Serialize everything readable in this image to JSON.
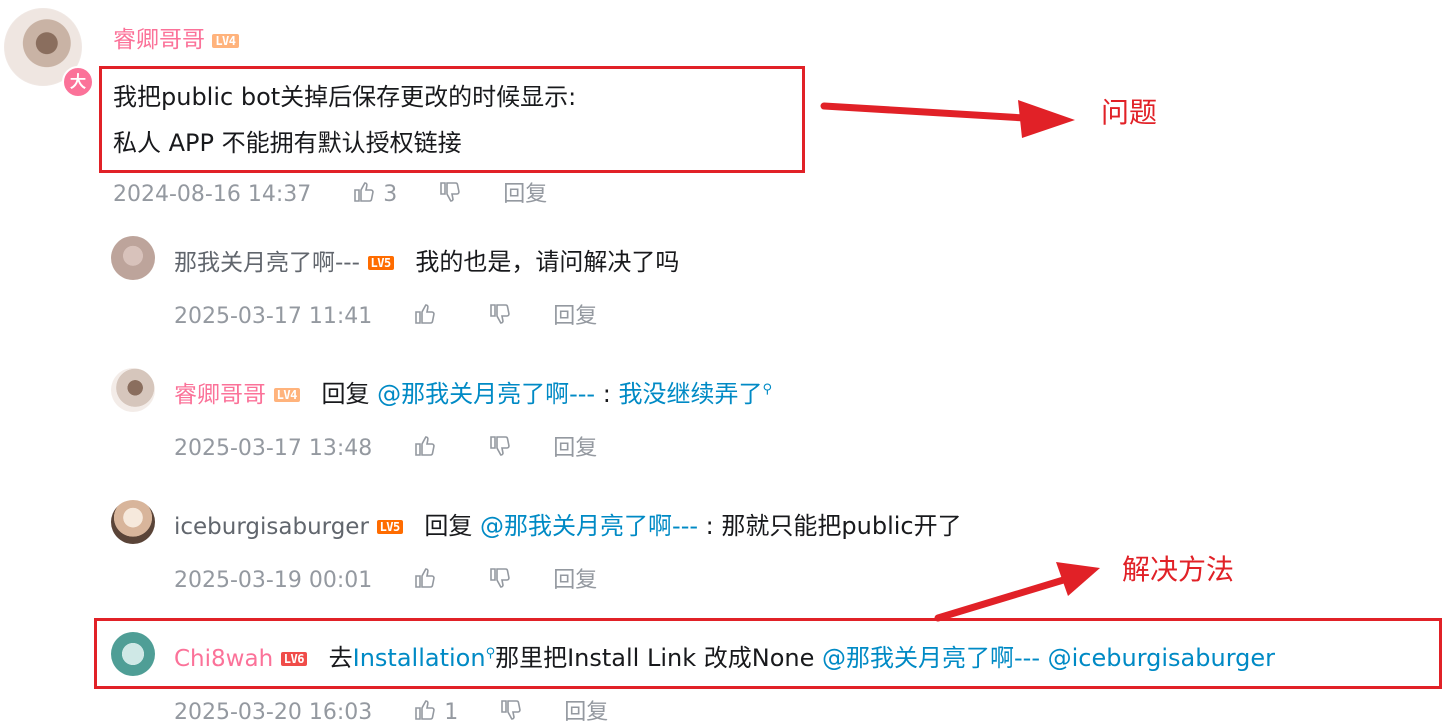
{
  "colors": {
    "pink_name": "#fb7299",
    "link_blue": "#008ac5",
    "meta_gray": "#9499a0",
    "annotation_red": "#e12127",
    "level_lv4": "#ffb37c",
    "level_lv5": "#ff6c00",
    "level_lv6": "#f04c49"
  },
  "main_comment": {
    "username": "睿卿哥哥",
    "level": "LV4",
    "badge": "大",
    "line1": "我把public bot关掉后保存更改的时候显示:",
    "line2": "私人 APP 不能拥有默认授权链接",
    "time": "2024-08-16 14:37",
    "likes": "3",
    "reply_label": "回复"
  },
  "replies": [
    {
      "username": "那我关月亮了啊---",
      "level": "LV5",
      "text": "我的也是，请问解决了吗",
      "time": "2025-03-17 11:41",
      "reply_label": "回复"
    },
    {
      "username": "睿卿哥哥",
      "level": "LV4",
      "prefix": "回复",
      "mention": "@那我关月亮了啊---",
      "separator": ":",
      "text": "我没继续弄了",
      "time": "2025-03-17 13:48",
      "reply_label": "回复"
    },
    {
      "username": "iceburgisaburger",
      "level": "LV5",
      "prefix": "回复",
      "mention": "@那我关月亮了啊---",
      "separator": ":",
      "text": "那就只能把public开了",
      "time": "2025-03-19 00:01",
      "reply_label": "回复"
    },
    {
      "username": "Chi8wah",
      "level": "LV6",
      "text_a": "去",
      "link_a": "Installation",
      "text_b": "那里把Install Link 改成None",
      "mention1": "@那我关月亮了啊---",
      "mention2": "@iceburgisaburger",
      "time": "2025-03-20 16:03",
      "likes": "1",
      "reply_label": "回复"
    }
  ],
  "annotations": {
    "problem": "问题",
    "solution": "解决方法"
  },
  "icons": [
    "thumbs-up-icon",
    "thumbs-down-icon",
    "search-icon",
    "arrow-icon"
  ]
}
